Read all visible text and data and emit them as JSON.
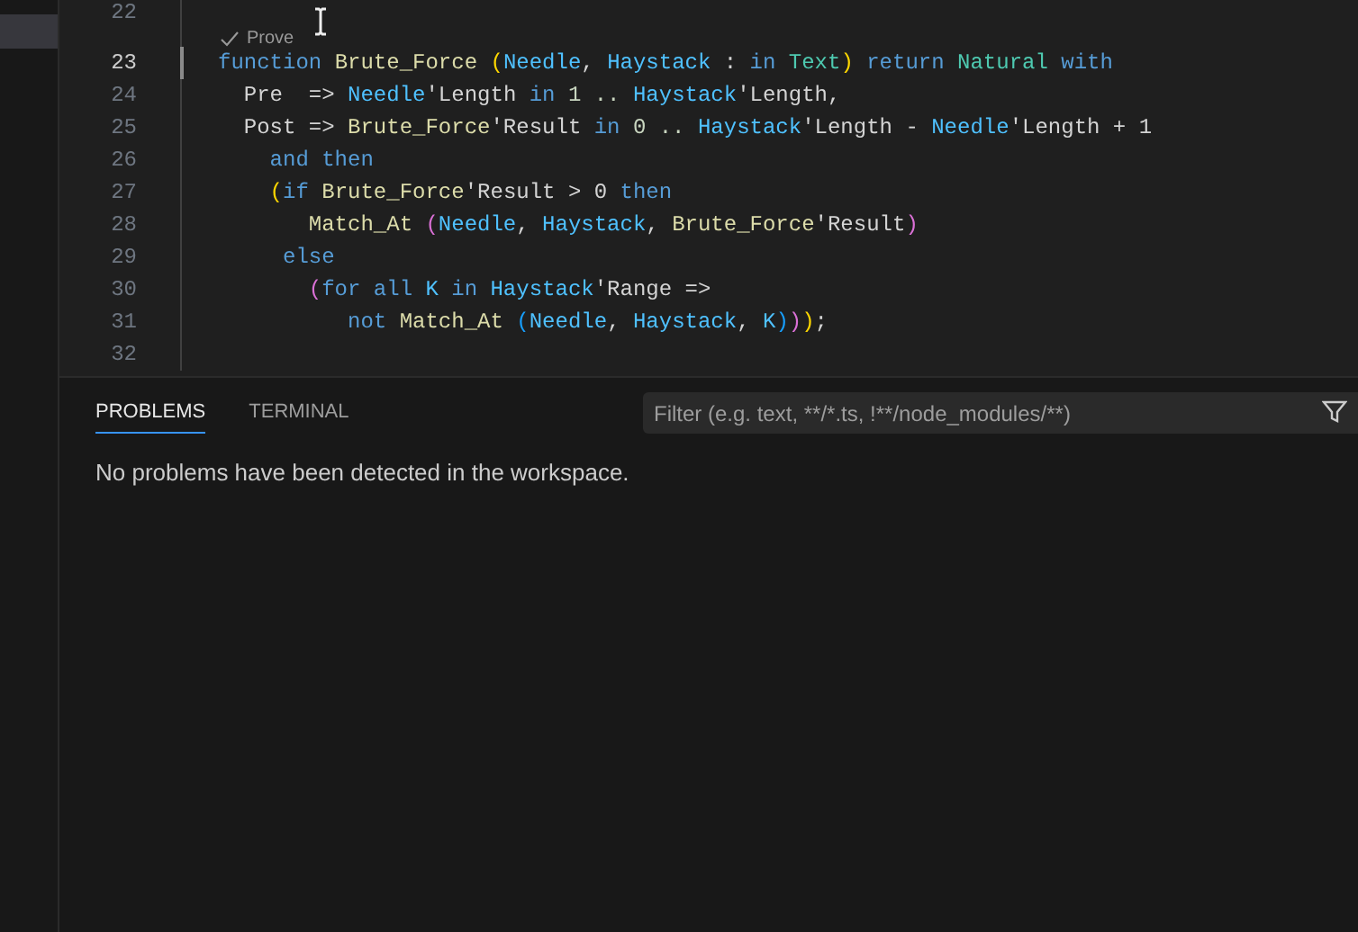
{
  "sidebar": {
    "items": [
      {
        "selected": true
      }
    ]
  },
  "editor": {
    "lines": [
      {
        "number": "22",
        "active": false
      },
      {
        "number": "23",
        "active": true,
        "code_lens": {
          "label": "Prove"
        },
        "tokens": [
          {
            "text": "function ",
            "kind": "keyword"
          },
          {
            "text": "Brute_Force ",
            "kind": "function"
          },
          {
            "text": "(",
            "kind": "paren1"
          },
          {
            "text": "Needle",
            "kind": "variable"
          },
          {
            "text": ", ",
            "kind": "plain"
          },
          {
            "text": "Haystack",
            "kind": "variable"
          },
          {
            "text": " : ",
            "kind": "plain"
          },
          {
            "text": "in ",
            "kind": "keyword"
          },
          {
            "text": "Text",
            "kind": "type"
          },
          {
            "text": ")",
            "kind": "paren1"
          },
          {
            "text": " return ",
            "kind": "keyword"
          },
          {
            "text": "Natural ",
            "kind": "type"
          },
          {
            "text": "with",
            "kind": "keyword"
          }
        ]
      },
      {
        "number": "24",
        "active": false,
        "tokens": [
          {
            "text": "  Pre  => ",
            "kind": "plain"
          },
          {
            "text": "Needle",
            "kind": "variable"
          },
          {
            "text": "'Length ",
            "kind": "plain"
          },
          {
            "text": "in ",
            "kind": "keyword"
          },
          {
            "text": "1 .. ",
            "kind": "number"
          },
          {
            "text": "Haystack",
            "kind": "variable"
          },
          {
            "text": "'Length,",
            "kind": "plain"
          }
        ]
      },
      {
        "number": "25",
        "active": false,
        "tokens": [
          {
            "text": "  Post => ",
            "kind": "plain"
          },
          {
            "text": "Brute_Force",
            "kind": "function"
          },
          {
            "text": "'Result ",
            "kind": "plain"
          },
          {
            "text": "in ",
            "kind": "keyword"
          },
          {
            "text": "0 .. ",
            "kind": "number"
          },
          {
            "text": "Haystack",
            "kind": "variable"
          },
          {
            "text": "'Length - ",
            "kind": "plain"
          },
          {
            "text": "Needle",
            "kind": "variable"
          },
          {
            "text": "'Length + 1",
            "kind": "plain"
          }
        ]
      },
      {
        "number": "26",
        "active": false,
        "tokens": [
          {
            "text": "    and then",
            "kind": "keyword"
          }
        ]
      },
      {
        "number": "27",
        "active": false,
        "tokens": [
          {
            "text": "    (",
            "kind": "paren1"
          },
          {
            "text": "if ",
            "kind": "keyword"
          },
          {
            "text": "Brute_Force",
            "kind": "function"
          },
          {
            "text": "'Result > 0 ",
            "kind": "plain"
          },
          {
            "text": "then",
            "kind": "keyword"
          }
        ]
      },
      {
        "number": "28",
        "active": false,
        "tokens": [
          {
            "text": "       Match_At ",
            "kind": "function"
          },
          {
            "text": "(",
            "kind": "paren2"
          },
          {
            "text": "Needle",
            "kind": "variable"
          },
          {
            "text": ", ",
            "kind": "plain"
          },
          {
            "text": "Haystack",
            "kind": "variable"
          },
          {
            "text": ", ",
            "kind": "plain"
          },
          {
            "text": "Brute_Force",
            "kind": "function"
          },
          {
            "text": "'Result",
            "kind": "plain"
          },
          {
            "text": ")",
            "kind": "paren2"
          }
        ]
      },
      {
        "number": "29",
        "active": false,
        "tokens": [
          {
            "text": "     else",
            "kind": "keyword"
          }
        ]
      },
      {
        "number": "30",
        "active": false,
        "tokens": [
          {
            "text": "       (",
            "kind": "paren2"
          },
          {
            "text": "for all ",
            "kind": "keyword"
          },
          {
            "text": "K ",
            "kind": "variable"
          },
          {
            "text": "in ",
            "kind": "keyword"
          },
          {
            "text": "Haystack",
            "kind": "variable"
          },
          {
            "text": "'Range =>",
            "kind": "plain"
          }
        ]
      },
      {
        "number": "31",
        "active": false,
        "tokens": [
          {
            "text": "          not ",
            "kind": "keyword"
          },
          {
            "text": "Match_At ",
            "kind": "function"
          },
          {
            "text": "(",
            "kind": "paren3"
          },
          {
            "text": "Needle",
            "kind": "variable"
          },
          {
            "text": ", ",
            "kind": "plain"
          },
          {
            "text": "Haystack",
            "kind": "variable"
          },
          {
            "text": ", ",
            "kind": "plain"
          },
          {
            "text": "K",
            "kind": "variable"
          },
          {
            "text": ")",
            "kind": "paren3"
          },
          {
            "text": ")",
            "kind": "paren2"
          },
          {
            "text": ")",
            "kind": "paren1"
          },
          {
            "text": ";",
            "kind": "plain"
          }
        ]
      },
      {
        "number": "32",
        "active": false
      }
    ]
  },
  "panel": {
    "tabs": [
      {
        "label": "PROBLEMS",
        "selected": true
      },
      {
        "label": "TERMINAL",
        "selected": false
      }
    ],
    "filter": {
      "placeholder": "Filter (e.g. text, **/*.ts, !**/node_modules/**)"
    },
    "message": "No problems have been detected in the workspace."
  }
}
